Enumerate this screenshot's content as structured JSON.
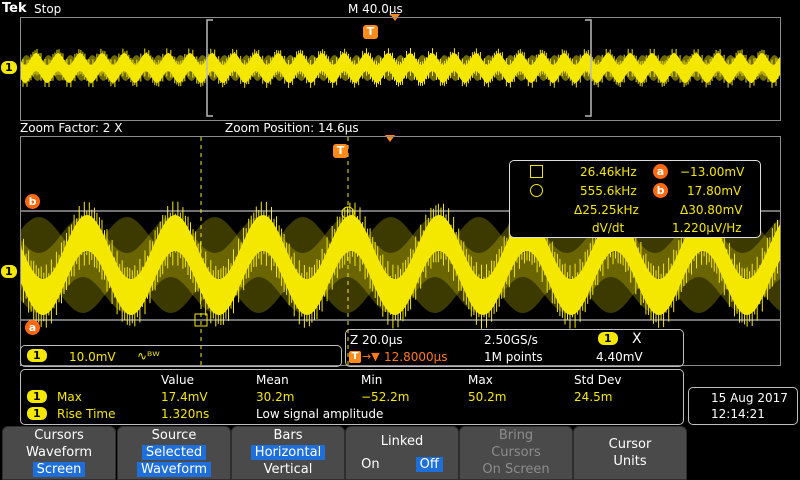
{
  "header": {
    "brand": "Tek",
    "run_state": "Stop",
    "timebase": "M 40.0µs"
  },
  "zoom": {
    "factor": "Zoom Factor: 2 X",
    "position": "Zoom Position: 14.6µs"
  },
  "markers": {
    "trigger": "T",
    "ch1": "1",
    "ref_a": "a",
    "ref_b": "b"
  },
  "cursor_readout": {
    "row1_freq": "26.46kHz",
    "row1_val": "−13.00mV",
    "row2_freq": "555.6kHz",
    "row2_val": "17.80mV",
    "delta_freq": "Δ25.25kHz",
    "delta_val": "Δ30.80mV",
    "dvdt_label": "dV/dt",
    "dvdt_val": "1.220µV/Hz"
  },
  "channel": {
    "label": "1",
    "scale": "10.0mV",
    "coupling": "∿ᴮᵂ"
  },
  "acquisition": {
    "zoom_scale": "Z 20.0µs",
    "sample_rate": "2.50GS/s",
    "record": "1M points",
    "trig_pos": "12.8000µs",
    "trig_ch": "1",
    "trig_level": "4.40mV",
    "trig_type": "X"
  },
  "measurements": {
    "headers": [
      "Value",
      "Mean",
      "Min",
      "Max",
      "Std Dev"
    ],
    "rows": [
      {
        "ch": "1",
        "name": "Max",
        "value": "17.4mV",
        "mean": "30.2m",
        "min": "−52.2m",
        "max": "50.2m",
        "std": "24.5m"
      },
      {
        "ch": "1",
        "name": "Rise Time",
        "value": "1.320ns",
        "note": "Low signal amplitude"
      }
    ]
  },
  "datetime": {
    "date": "15 Aug 2017",
    "time": "12:14:21"
  },
  "softkeys": {
    "cursors": {
      "l1": "Cursors",
      "l2": "Waveform",
      "l3": "Screen"
    },
    "source": {
      "l1": "Source",
      "l2": "Selected",
      "l3": "Waveform"
    },
    "bars": {
      "l1": "Bars",
      "l2": "Horizontal",
      "l3": "Vertical"
    },
    "linked": {
      "l1": "Linked",
      "on": "On",
      "off": "Off"
    },
    "bring": {
      "l1": "Bring",
      "l2": "Cursors",
      "l3": "On Screen"
    },
    "units": {
      "l1": "Cursor",
      "l2": "Units"
    }
  },
  "colors": {
    "trace": "#f5e800",
    "cursor": "#ff7a1a",
    "highlight": "#1e6fd9"
  }
}
